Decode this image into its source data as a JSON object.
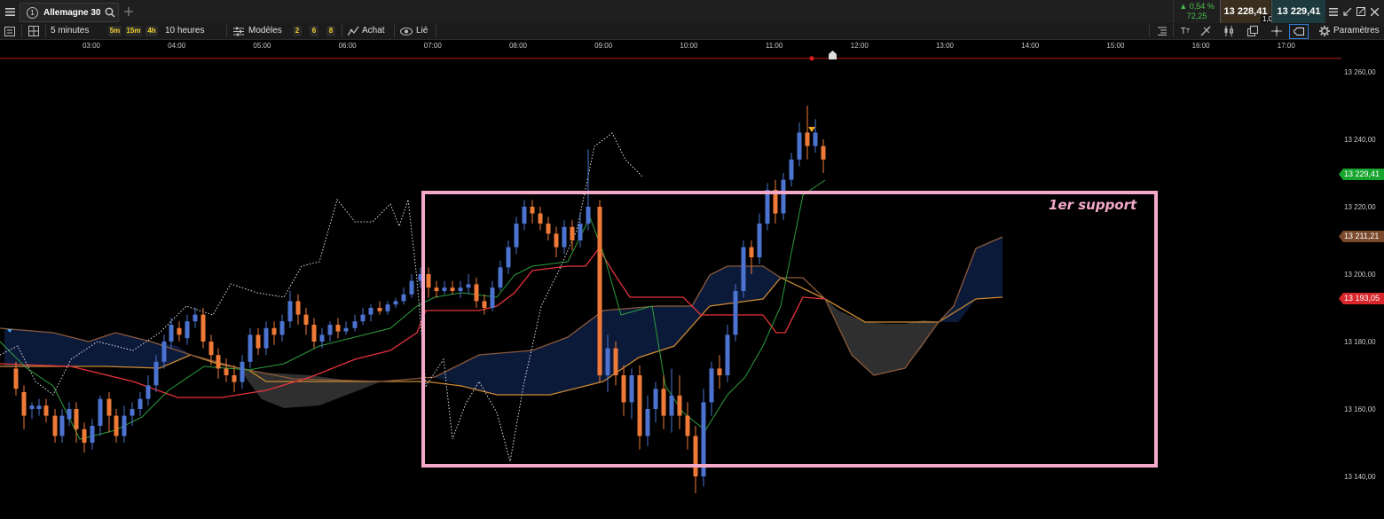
{
  "header": {
    "tab_number": "1",
    "instrument": "Allemagne 30",
    "change_percent": "0,54 %",
    "change_points": "72,25",
    "sell_price": "13 228,41",
    "spread": "1,00",
    "buy_price": "13 229,41"
  },
  "toolbar": {
    "timeframe": "5 minutes",
    "tf_5m": "5m",
    "tf_15m": "15m",
    "tf_4h": "4h",
    "range": "10 heures",
    "models_label": "Modèles",
    "model_2": "2",
    "model_6": "6",
    "model_8": "8",
    "buy_label": "Achat",
    "linked_label": "Lié",
    "settings_label": "Paramètres"
  },
  "chart_data": {
    "type": "candlestick",
    "instrument": "Allemagne 30",
    "x_tick_labels": [
      "03:00",
      "04:00",
      "05:00",
      "06:00",
      "07:00",
      "08:00",
      "09:00",
      "10:00",
      "11:00",
      "12:00",
      "13:00",
      "14:00",
      "15:00",
      "16:00",
      "17:00"
    ],
    "y_tick_labels": [
      "13 260,00",
      "13 240,00",
      "13 220,00",
      "13 200,00",
      "13 180,00",
      "13 160,00",
      "13 140,00"
    ],
    "ylim": [
      13136,
      13275
    ],
    "current_price_tag": "13 229,41",
    "level_tag_upper": "13 211,21",
    "level_tag_lower": "13 193,05",
    "reference_line_value": 13264,
    "annotation": "1er support",
    "grid": false,
    "colors": {
      "up": "#4d73d1",
      "down": "#ef7a37",
      "tenkan": "#e8333b",
      "kijun": "#2e9e3d",
      "senkou_b": "#cc8a33",
      "chikou": "#dddddd",
      "bull_cloud": "#0c1a3a",
      "bear_cloud": "#2f2f2f",
      "annotation": "#f4a9c9"
    }
  }
}
